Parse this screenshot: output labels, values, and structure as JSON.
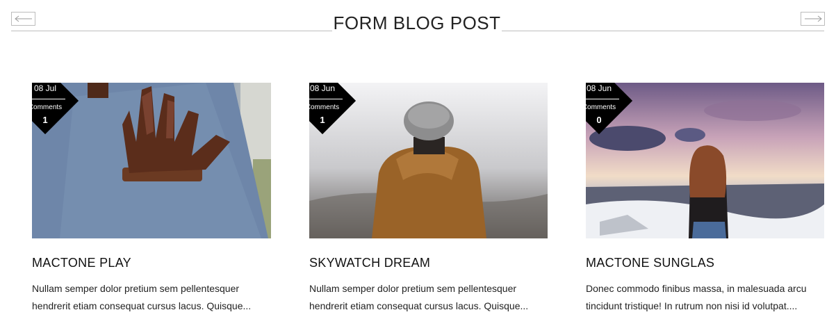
{
  "section": {
    "title": "FORM BLOG POST"
  },
  "nav": {
    "prev_icon": "arrow-left-icon",
    "next_icon": "arrow-right-icon"
  },
  "posts": [
    {
      "date": "08 Jul",
      "comments_label": "Comments",
      "comments_count": "1",
      "title": "MACTONE PLAY",
      "excerpt": "Nullam semper dolor pretium sem pellentesquer hendrerit etiam consequat cursus lacus. Quisque...",
      "image": "brown-leather-glove-tweed-jacket-photo"
    },
    {
      "date": "08 Jun",
      "comments_label": "Comments",
      "comments_count": "1",
      "title": "SKYWATCH DREAM",
      "excerpt": "Nullam semper dolor pretium sem pellentesquer hendrerit etiam consequat cursus lacus. Quisque...",
      "image": "person-in-beanie-foggy-landscape-photo"
    },
    {
      "date": "08 Jun",
      "comments_label": "Comments",
      "comments_count": "0",
      "title": "MACTONE SUNGLAS",
      "excerpt": "Donec commodo finibus massa, in malesuada arcu tincidunt tristique! In rutrum non nisi id volutpat....",
      "image": "woman-snowy-mountain-sunset-photo"
    }
  ],
  "colors": {
    "badge": "#000000",
    "divider": "#bdbdbd",
    "text": "#111111"
  }
}
